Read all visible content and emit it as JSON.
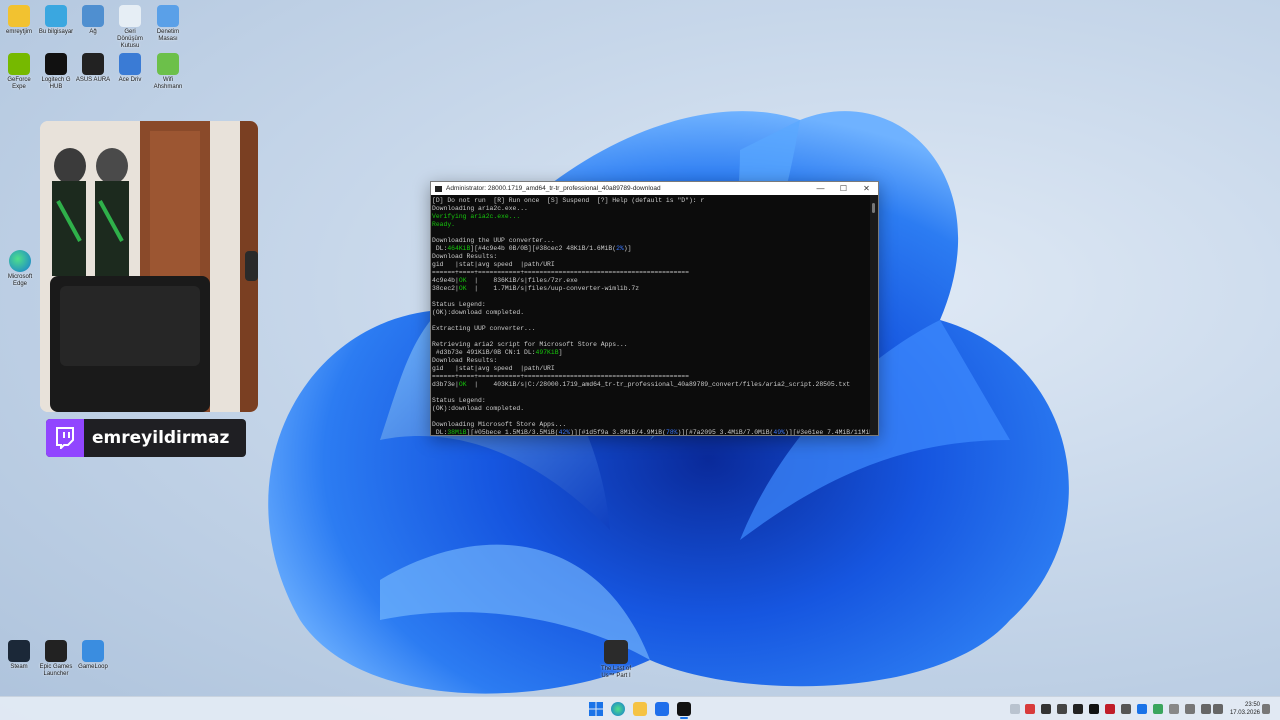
{
  "desktop": {
    "icons_top_row": [
      {
        "label": "emreytjim",
        "color": "#f2c230"
      },
      {
        "label": "Bu bilgisayar",
        "color": "#3aa7e0"
      },
      {
        "label": "Ağ",
        "color": "#4f8fd0"
      },
      {
        "label": "Geri Dönüşüm Kutusu",
        "color": "#e6eef5"
      },
      {
        "label": "Denetim Masası",
        "color": "#5aa0e8"
      }
    ],
    "icons_second_row": [
      {
        "label": "GeForce Expe",
        "color": "#76b900"
      },
      {
        "label": "Logitech G HUB",
        "color": "#111111"
      },
      {
        "label": "ASUS AURA",
        "color": "#222222"
      },
      {
        "label": "Ace Driv",
        "color": "#3a7bd5"
      },
      {
        "label": "Wifi Ahshmann",
        "color": "#6cc04a"
      }
    ],
    "icon_edge": {
      "label": "Microsoft Edge"
    },
    "icons_bottom": [
      {
        "label": "Steam",
        "color": "#1b2838"
      },
      {
        "label": "Epic Games Launcher",
        "color": "#222222"
      },
      {
        "label": "GameLoop",
        "color": "#3a8de0"
      }
    ],
    "icon_game": {
      "label": "The Last of Us™ Part I"
    }
  },
  "twitch": {
    "username": "emreyildirmaz"
  },
  "terminal": {
    "title": "Administrator: 28000.1719_amd64_tr-tr_professional_40a89789-download",
    "lines": [
      [
        {
          "t": "[D] Do not run  [R] Run once  [S] Suspend  [?] Help (default is \"D\"): r"
        }
      ],
      [
        {
          "t": "Downloading aria2c.exe..."
        }
      ],
      [
        {
          "t": "Verifying aria2c.exe...",
          "c": "g"
        }
      ],
      [
        {
          "t": "Ready.",
          "c": "g"
        }
      ],
      [
        {
          "t": ""
        }
      ],
      [
        {
          "t": "Downloading the UUP converter..."
        }
      ],
      [
        {
          "t": " DL:"
        },
        {
          "t": "464KiB",
          "c": "g"
        },
        {
          "t": "][#4c9e4b 0B/0B][#38cec2 48KiB/1.6MiB("
        },
        {
          "t": "2%",
          "c": "b"
        },
        {
          "t": ")]"
        }
      ],
      [
        {
          "t": "Download Results:"
        }
      ],
      [
        {
          "t": "gid   |stat|avg speed  |path/URI"
        }
      ],
      [
        {
          "t": "======+====+===========+==========================================="
        }
      ],
      [
        {
          "t": "4c9e4b|"
        },
        {
          "t": "OK",
          "c": "g"
        },
        {
          "t": "  |    836KiB/s|files/7zr.exe"
        }
      ],
      [
        {
          "t": "38cec2|"
        },
        {
          "t": "OK",
          "c": "g"
        },
        {
          "t": "  |    1.7MiB/s|files/uup-converter-wimlib.7z"
        }
      ],
      [
        {
          "t": ""
        }
      ],
      [
        {
          "t": "Status Legend:"
        }
      ],
      [
        {
          "t": "(OK):download completed."
        }
      ],
      [
        {
          "t": ""
        }
      ],
      [
        {
          "t": "Extracting UUP converter..."
        }
      ],
      [
        {
          "t": ""
        }
      ],
      [
        {
          "t": "Retrieving aria2 script for Microsoft Store Apps..."
        }
      ],
      [
        {
          "t": " #d3b73e 491KiB/0B CN:1 DL:"
        },
        {
          "t": "497KiB",
          "c": "g"
        },
        {
          "t": "]"
        }
      ],
      [
        {
          "t": "Download Results:"
        }
      ],
      [
        {
          "t": "gid   |stat|avg speed  |path/URI"
        }
      ],
      [
        {
          "t": "======+====+===========+==========================================="
        }
      ],
      [
        {
          "t": "d3b73e|"
        },
        {
          "t": "OK",
          "c": "g"
        },
        {
          "t": "  |    403KiB/s|C:/28000.1719_amd64_tr-tr_professional_40a89789_convert/files/aria2_script.28505.txt"
        }
      ],
      [
        {
          "t": ""
        }
      ],
      [
        {
          "t": "Status Legend:"
        }
      ],
      [
        {
          "t": "(OK):download completed."
        }
      ],
      [
        {
          "t": ""
        }
      ],
      [
        {
          "t": "Downloading Microsoft Store Apps..."
        }
      ],
      [
        {
          "t": " DL:"
        },
        {
          "t": "38MiB",
          "c": "g"
        },
        {
          "t": "][#05bece 1.5MiB/3.5MiB("
        },
        {
          "t": "42%",
          "c": "b"
        },
        {
          "t": ")][#1d5f9a 3.8MiB/4.9MiB("
        },
        {
          "t": "78%",
          "c": "b"
        },
        {
          "t": ")][#7a2095 3.4MiB/7.0MiB("
        },
        {
          "t": "49%",
          "c": "b"
        },
        {
          "t": ")][#3e61ee 7.4MiB/11MiB("
        },
        {
          "t": "66",
          "c": "b"
        }
      ]
    ],
    "controls": {
      "minimize": "—",
      "maximize": "☐",
      "close": "✕"
    }
  },
  "taskbar": {
    "clock_time": "23:50",
    "clock_date": "17.03.2026"
  }
}
